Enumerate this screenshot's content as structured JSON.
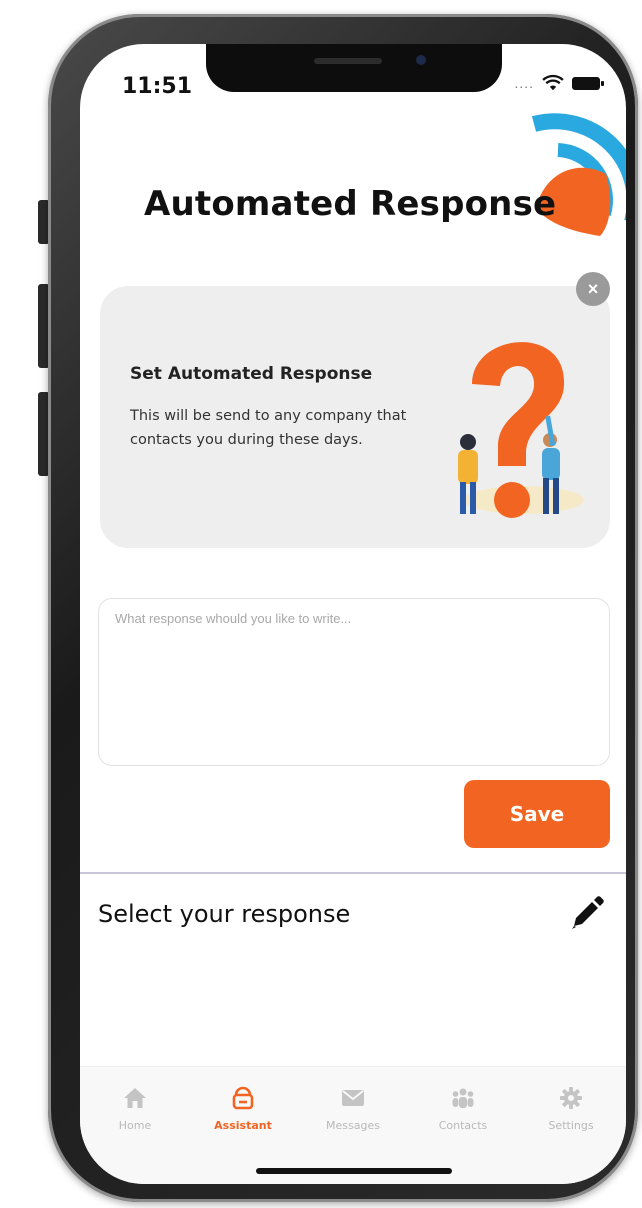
{
  "status": {
    "time": "11:51",
    "signal_dots": "...."
  },
  "page": {
    "title": "Automated Response"
  },
  "card": {
    "heading": "Set Automated Response",
    "description": "This will be send to any company that contacts you during these days.",
    "close_glyph": "×"
  },
  "response": {
    "placeholder": "What response whould you like to write..."
  },
  "actions": {
    "save_label": "Save"
  },
  "selector": {
    "label": "Select your response"
  },
  "tabs": [
    {
      "label": "Home",
      "icon": "home-icon"
    },
    {
      "label": "Assistant",
      "icon": "assistant-icon"
    },
    {
      "label": "Messages",
      "icon": "mail-icon"
    },
    {
      "label": "Contacts",
      "icon": "contacts-icon"
    },
    {
      "label": "Settings",
      "icon": "gear-icon"
    }
  ],
  "active_tab": "Assistant",
  "colors": {
    "accent": "#f26422",
    "logo_blue": "#2aa8e0",
    "card_bg": "#eeeeee"
  }
}
